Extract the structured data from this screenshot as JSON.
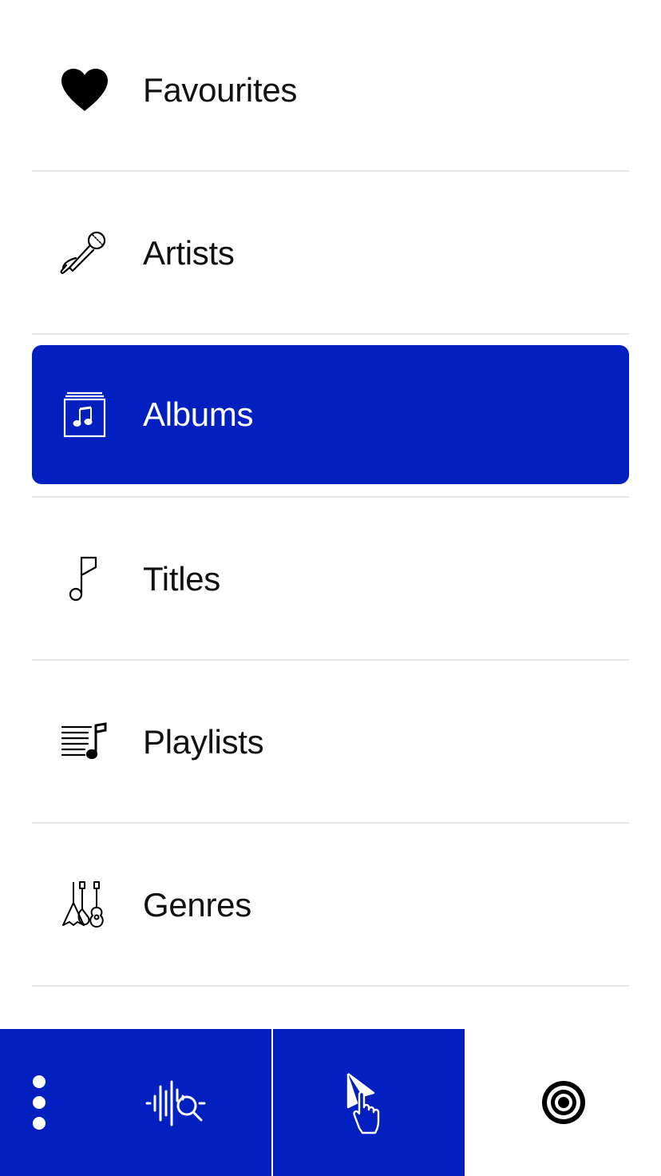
{
  "menu": {
    "items": [
      {
        "label": "Favourites",
        "icon": "heart-icon",
        "selected": false
      },
      {
        "label": "Artists",
        "icon": "microphone-icon",
        "selected": false
      },
      {
        "label": "Albums",
        "icon": "album-icon",
        "selected": true
      },
      {
        "label": "Titles",
        "icon": "music-note-icon",
        "selected": false
      },
      {
        "label": "Playlists",
        "icon": "playlist-icon",
        "selected": false
      },
      {
        "label": "Genres",
        "icon": "guitars-icon",
        "selected": false
      }
    ]
  },
  "bottom_bar": {
    "buttons": [
      {
        "icon": "more-vertical-icon"
      },
      {
        "icon": "audio-search-icon"
      },
      {
        "icon": "touch-play-icon"
      },
      {
        "icon": "target-icon"
      }
    ]
  },
  "colors": {
    "accent": "#0220c0",
    "text": "#111111",
    "divider": "#e6e6e6",
    "background": "#ffffff"
  }
}
